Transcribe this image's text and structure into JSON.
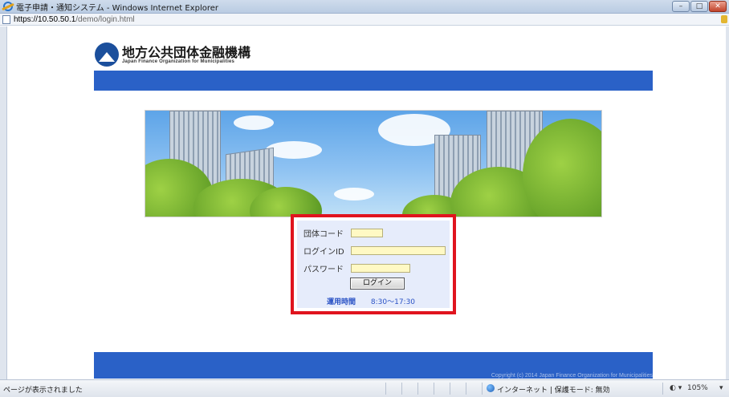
{
  "window": {
    "title": "電子申請・通知システム - Windows Internet Explorer",
    "controls": {
      "minimize": "–",
      "maximize": "□",
      "close": "✕"
    }
  },
  "address": {
    "host": "https://10.50.50.1",
    "path": "/demo/login.html"
  },
  "logo": {
    "name_jp": "地方公共団体金融機構",
    "name_en": "Japan Finance Organization for Municipalities"
  },
  "login": {
    "group_code_label": "団体コード",
    "group_code_value": "",
    "login_id_label": "ログインID",
    "login_id_value": "",
    "password_label": "パスワード",
    "password_value": "",
    "submit_label": "ログイン",
    "hours_label": "運用時間",
    "hours_value": "8:30〜17:30"
  },
  "footer": {
    "copyright": "Copyright (c) 2014 Japan Finance Organization for Municipalities"
  },
  "status": {
    "left_text": "ページが表示されました",
    "zone_text": "インターネット | 保護モード: 無効",
    "zoom_icon": "◐ ▾",
    "zoom": "105%",
    "zoom_caret": "▾"
  },
  "colors": {
    "band": "#2a61c7",
    "highlight": "#e0141e",
    "field": "#fff9c4",
    "panel": "#e6ecfb"
  },
  "icons": [
    "ie-logo-icon",
    "page-icon",
    "lock-icon",
    "logo-mark-icon",
    "dropdown-arrow-icon",
    "globe-icon"
  ]
}
